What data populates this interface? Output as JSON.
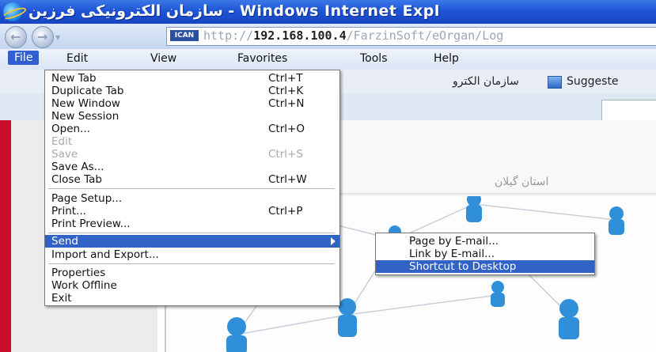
{
  "window": {
    "title": "سازمان الکترونیکی فرزین - Windows Internet Expl"
  },
  "address": {
    "badge": "ICAN",
    "url_prefix": "http://",
    "url_host": "192.168.100.4",
    "url_path": "/FarzinSoft/eOrgan/Log"
  },
  "menubar": {
    "items": [
      "File",
      "Edit",
      "View",
      "Favorites",
      "Tools",
      "Help"
    ]
  },
  "favorites": {
    "site_label": "سازمان الکترو",
    "suggested_label": "Suggeste"
  },
  "page": {
    "farsi_heading": "استان گیلان"
  },
  "file_menu": {
    "items": [
      {
        "label": "New Tab",
        "shortcut": "Ctrl+T"
      },
      {
        "label": "Duplicate Tab",
        "shortcut": "Ctrl+K"
      },
      {
        "label": "New Window",
        "shortcut": "Ctrl+N"
      },
      {
        "label": "New Session",
        "shortcut": ""
      },
      {
        "label": "Open...",
        "shortcut": "Ctrl+O"
      },
      {
        "label": "Edit",
        "shortcut": ""
      },
      {
        "label": "Save",
        "shortcut": "Ctrl+S"
      },
      {
        "label": "Save As...",
        "shortcut": ""
      },
      {
        "label": "Close Tab",
        "shortcut": "Ctrl+W"
      },
      {
        "label": "Page Setup...",
        "shortcut": ""
      },
      {
        "label": "Print...",
        "shortcut": "Ctrl+P"
      },
      {
        "label": "Print Preview...",
        "shortcut": ""
      },
      {
        "label": "Send",
        "shortcut": ""
      },
      {
        "label": "Import and Export...",
        "shortcut": ""
      },
      {
        "label": "Properties",
        "shortcut": ""
      },
      {
        "label": "Work Offline",
        "shortcut": ""
      },
      {
        "label": "Exit",
        "shortcut": ""
      }
    ]
  },
  "send_submenu": {
    "items": [
      {
        "label": "Page by E-mail..."
      },
      {
        "label": "Link by E-mail..."
      },
      {
        "label": "Shortcut to Desktop"
      }
    ]
  },
  "colors": {
    "titlebar": "#1f55d6",
    "selection": "#3163c7",
    "frame_red": "#c8102e"
  }
}
